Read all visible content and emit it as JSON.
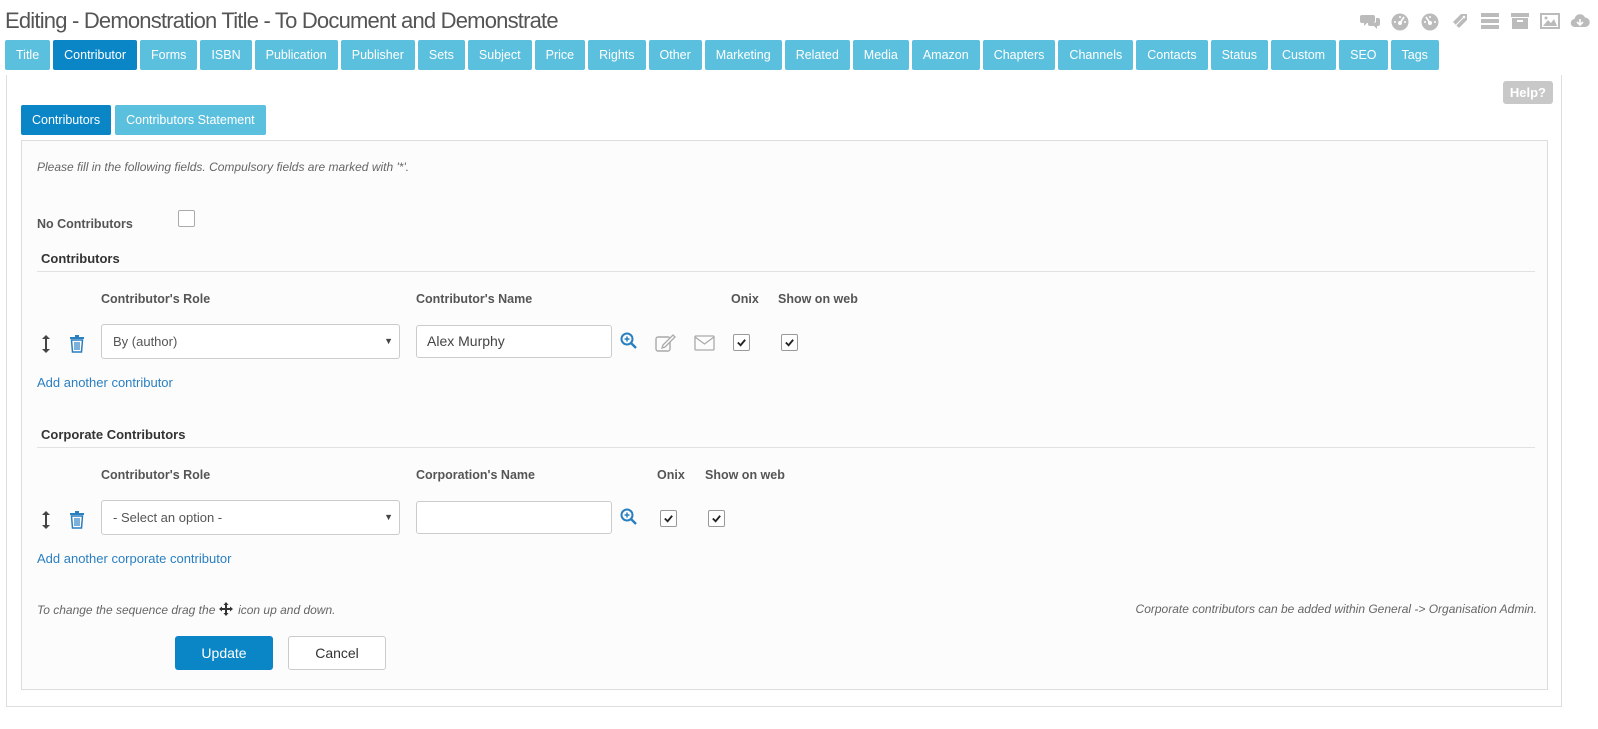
{
  "page": {
    "title": "Editing - Demonstration Title - To Document and Demonstrate"
  },
  "top_icons": [
    "comments-icon",
    "dashboard-icon",
    "dashboard-alt-icon",
    "tag-icon",
    "list-icon",
    "archive-icon",
    "image-icon",
    "cloud-download-icon"
  ],
  "tabs": [
    {
      "label": "Title"
    },
    {
      "label": "Contributor",
      "active": true
    },
    {
      "label": "Forms"
    },
    {
      "label": "ISBN"
    },
    {
      "label": "Publication"
    },
    {
      "label": "Publisher"
    },
    {
      "label": "Sets"
    },
    {
      "label": "Subject"
    },
    {
      "label": "Price"
    },
    {
      "label": "Rights"
    },
    {
      "label": "Other"
    },
    {
      "label": "Marketing"
    },
    {
      "label": "Related"
    },
    {
      "label": "Media"
    },
    {
      "label": "Amazon"
    },
    {
      "label": "Chapters"
    },
    {
      "label": "Channels"
    },
    {
      "label": "Contacts"
    },
    {
      "label": "Status"
    },
    {
      "label": "Custom"
    },
    {
      "label": "SEO"
    },
    {
      "label": "Tags"
    }
  ],
  "help_label": "Help?",
  "subtabs": [
    {
      "label": "Contributors",
      "active": true
    },
    {
      "label": "Contributors Statement"
    }
  ],
  "form": {
    "intro": "Please fill in the following fields. Compulsory fields are marked with '*'.",
    "no_contributors_label": "No Contributors",
    "no_contributors_checked": false,
    "contributors": {
      "section_title": "Contributors",
      "col_role": "Contributor's Role",
      "col_name": "Contributor's Name",
      "col_onix": "Onix",
      "col_show_web": "Show on web",
      "row": {
        "role": "By (author)",
        "name": "Alex Murphy",
        "onix": true,
        "show_on_web": true
      },
      "add_link": "Add another contributor"
    },
    "corporate": {
      "section_title": "Corporate Contributors",
      "col_role": "Contributor's Role",
      "col_name": "Corporation's Name",
      "col_onix": "Onix",
      "col_show_web": "Show on web",
      "row": {
        "role": "- Select an option -",
        "name": "",
        "onix": true,
        "show_on_web": true
      },
      "add_link": "Add another corporate contributor"
    },
    "footer_note_left_a": "To change the sequence drag the",
    "footer_note_left_b": "icon up and down.",
    "footer_note_right": "Corporate contributors can be added within General -> Organisation Admin.",
    "update_label": "Update",
    "cancel_label": "Cancel"
  },
  "colors": {
    "tab": "#5bc0de",
    "tab_active": "#0a86c7",
    "link": "#2a7fc0",
    "icon_blue": "#2a7fc0"
  }
}
